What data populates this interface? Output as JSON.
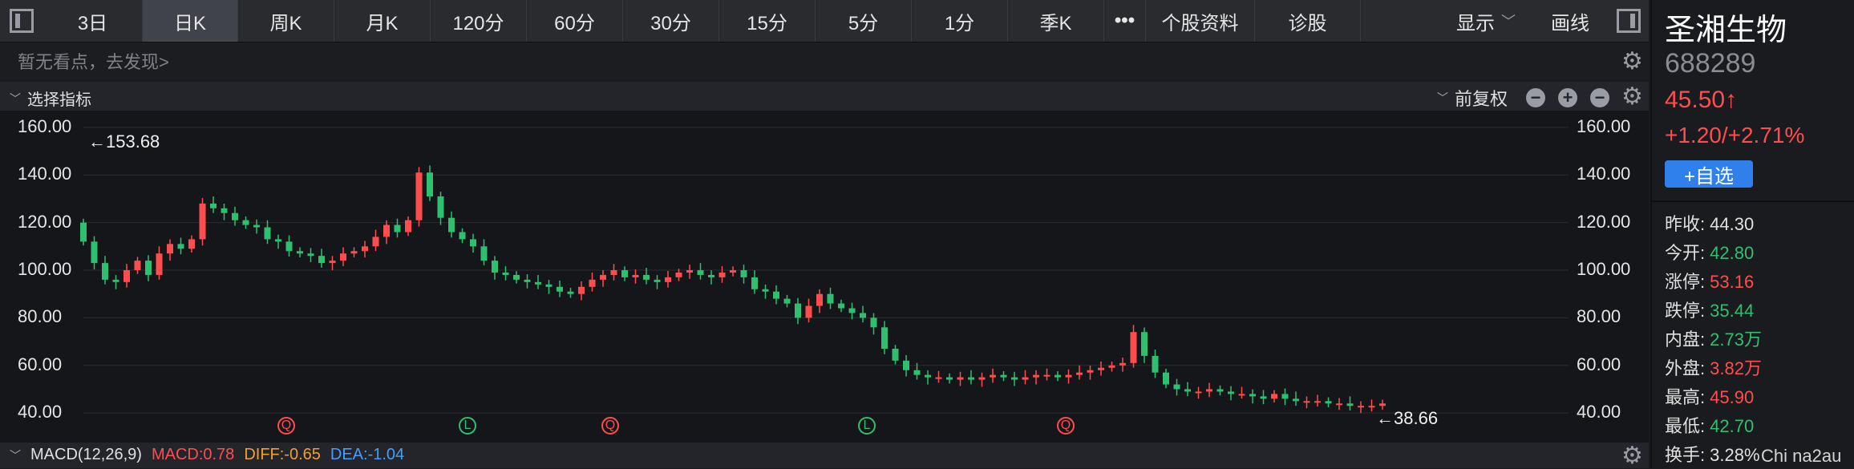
{
  "toolbar": {
    "tabs": [
      "3日",
      "日K",
      "周K",
      "月K",
      "120分",
      "60分",
      "30分",
      "15分",
      "5分",
      "1分",
      "季K"
    ],
    "active_tab": "日K",
    "more": "•••",
    "info": "个股资料",
    "diagnose": "诊股",
    "display": "显示",
    "draw": "画线"
  },
  "hint": "暂无看点，去发现>",
  "indicator": {
    "select_label": "选择指标",
    "adjust_label": "前复权"
  },
  "chart_data": {
    "type": "candlestick",
    "y_ticks": [
      "160.00",
      "140.00",
      "120.00",
      "100.00",
      "80.00",
      "60.00",
      "40.00"
    ],
    "ylim": [
      35,
      165
    ],
    "max_label": "←153.68",
    "min_label": "←38.66",
    "close_series": [
      112,
      103,
      96,
      95,
      100,
      104,
      98,
      107,
      111,
      109,
      113,
      128,
      126,
      124,
      121,
      119,
      118,
      113,
      112,
      108,
      107,
      106,
      103,
      104,
      107,
      108,
      110,
      114,
      119,
      116,
      121,
      141,
      131,
      122,
      116,
      113,
      110,
      104,
      99,
      98,
      96,
      95,
      94,
      93,
      91,
      90,
      93,
      96,
      98,
      100,
      97,
      98,
      96,
      95,
      97,
      99,
      100,
      98,
      97,
      99,
      100,
      97,
      92,
      91,
      88,
      86,
      80,
      85,
      90,
      86,
      84,
      82,
      80,
      76,
      67,
      62,
      58,
      56,
      55,
      55,
      54,
      55,
      54,
      55,
      56,
      55,
      54,
      55,
      56,
      56,
      55,
      56,
      57,
      58,
      59,
      60,
      61,
      74,
      64,
      57,
      52,
      50,
      49,
      49,
      50,
      49,
      48,
      48,
      47,
      46,
      48,
      46,
      45,
      45,
      45,
      44,
      44,
      43,
      43,
      43,
      44
    ],
    "markers": [
      {
        "label": "Q",
        "type": "red"
      },
      {
        "label": "L",
        "type": "green"
      },
      {
        "label": "Q",
        "type": "red"
      },
      {
        "label": "L",
        "type": "green"
      },
      {
        "label": "Q",
        "type": "red"
      }
    ]
  },
  "macd": {
    "name": "MACD(12,26,9)",
    "macd": "MACD:0.78",
    "diff": "DIFF:-0.65",
    "dea": "DEA:-1.04"
  },
  "stock": {
    "name": "圣湘生物",
    "code": "688289",
    "price": "45.50↑",
    "change": "+1.20/+2.71%",
    "add_btn": "+自选",
    "fields": [
      {
        "k": "昨收:",
        "v": "44.30",
        "c": "neutral"
      },
      {
        "k": "今开:",
        "v": "42.80",
        "c": "green"
      },
      {
        "k": "涨停:",
        "v": "53.16",
        "c": "red"
      },
      {
        "k": "跌停:",
        "v": "35.44",
        "c": "green"
      },
      {
        "k": "内盘:",
        "v": "2.73万",
        "c": "green"
      },
      {
        "k": "外盘:",
        "v": "3.82万",
        "c": "red"
      },
      {
        "k": "最高:",
        "v": "45.90",
        "c": "red"
      },
      {
        "k": "最低:",
        "v": "42.70",
        "c": "green"
      },
      {
        "k": "换手:",
        "v": "3.28%",
        "c": "neutral"
      }
    ]
  },
  "watermark": "Chi na2au",
  "colors": {
    "up": "#ff4d4f",
    "down": "#2fbf71",
    "accent": "#2f80ed"
  }
}
